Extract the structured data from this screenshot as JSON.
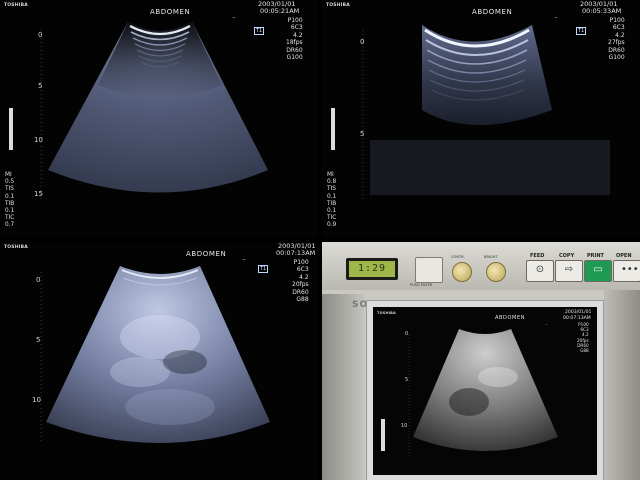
{
  "panels": [
    {
      "brand": "TOSHIBA",
      "region": "ABDOMEN",
      "date": "2003/01/01",
      "time": "00:05:21AM",
      "marker": "T1",
      "params": [
        "P100",
        "6C3",
        "4.2",
        "18fps",
        "DR60",
        "G100"
      ],
      "bottom_params": [
        "MI",
        "0.5",
        "TIS",
        "0.1",
        "TIB",
        "0.1",
        "TIC",
        "0.7"
      ],
      "depth_labels": [
        "0",
        "5",
        "10",
        "15"
      ]
    },
    {
      "brand": "TOSHIBA",
      "region": "ABDOMEN",
      "date": "2003/01/01",
      "time": "00:05:33AM",
      "marker": "T1",
      "params": [
        "P100",
        "6C3",
        "4.2",
        "27fps",
        "DR60",
        "G100"
      ],
      "bottom_params": [
        "MI",
        "0.8",
        "TIS",
        "0.1",
        "TIB",
        "0.1",
        "TIC",
        "0.9"
      ],
      "depth_labels": [
        "0",
        "5"
      ]
    },
    {
      "brand": "TOSHIBA",
      "region": "ABDOMEN",
      "date": "2003/01/01",
      "time": "00:07:13AM",
      "marker": "T1",
      "params": [
        "P100",
        "6C3",
        "4.2",
        "20fps",
        "DR60",
        "G88"
      ],
      "depth_labels": [
        "0",
        "5",
        "10"
      ]
    }
  ],
  "printer": {
    "lcd_value": "1:29",
    "push_enter_label": "PUSH ENTER",
    "knob_labels": [
      "CONTR.",
      "BRIGHT"
    ],
    "buttons": [
      "FEED",
      "COPY",
      "PRINT",
      "OPEN"
    ],
    "brand": "SONY",
    "print": {
      "brand": "TOSHIBA",
      "region": "ABDOMEN",
      "date": "2003/01/01",
      "time": "00:07:13AM",
      "params": [
        "P100",
        "6C3",
        "4.2",
        "20fps",
        "DR60",
        "G88"
      ],
      "depth_labels": [
        "0",
        "5",
        "10"
      ]
    }
  },
  "colors": {
    "print_button": "#1f9a52",
    "scan_tint": "#aeb9d6"
  }
}
